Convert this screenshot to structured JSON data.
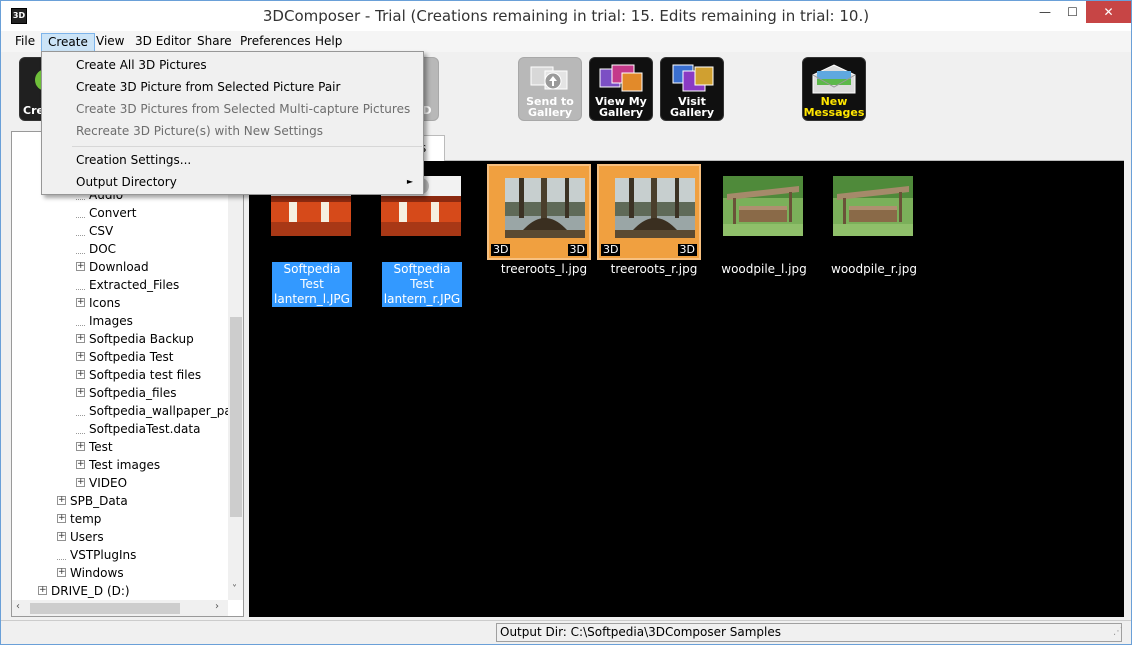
{
  "window": {
    "title": "3DComposer - Trial (Creations remaining in trial: 15. Edits remaining in trial: 10.)",
    "app_icon_text": "3D",
    "controls": {
      "minimize": "—",
      "maximize": "☐",
      "close": "✕"
    }
  },
  "menubar": {
    "items": [
      "File",
      "Create",
      "View",
      "3D Editor",
      "Share",
      "Preferences",
      "Help"
    ],
    "active": "Create"
  },
  "create_menu": {
    "items": [
      {
        "label": "Create All 3D Pictures",
        "enabled": true
      },
      {
        "label": "Create 3D Picture from Selected Picture Pair",
        "enabled": true
      },
      {
        "label": "Create 3D Pictures from Selected Multi-capture Pictures",
        "enabled": false
      },
      {
        "label": "Recreate 3D Picture(s) with New Settings",
        "enabled": false
      },
      {
        "label": "Creation Settings...",
        "enabled": true
      },
      {
        "label": "Output Directory",
        "enabled": true,
        "submenu": true
      }
    ],
    "submenu_arrow": "►"
  },
  "toolbar": {
    "partial_left_label": "Cre",
    "partial_right_label": "D",
    "send_to_gallery": "Send to Gallery",
    "view_my_gallery": "View My Gallery",
    "visit_gallery": "Visit Gallery",
    "new_messages": "New Messages"
  },
  "tree": {
    "items": [
      {
        "label": "Audio",
        "expandable": false,
        "partial": true
      },
      {
        "label": "Convert",
        "expandable": false
      },
      {
        "label": "CSV",
        "expandable": false
      },
      {
        "label": "DOC",
        "expandable": false
      },
      {
        "label": "Download",
        "expandable": true
      },
      {
        "label": "Extracted_Files",
        "expandable": false
      },
      {
        "label": "Icons",
        "expandable": true
      },
      {
        "label": "Images",
        "expandable": false
      },
      {
        "label": "Softpedia Backup",
        "expandable": true
      },
      {
        "label": "Softpedia Test",
        "expandable": true
      },
      {
        "label": "Softpedia test files",
        "expandable": true
      },
      {
        "label": "Softpedia_files",
        "expandable": true
      },
      {
        "label": "Softpedia_wallpaper_pack_",
        "expandable": false
      },
      {
        "label": "SoftpediaTest.data",
        "expandable": false
      },
      {
        "label": "Test",
        "expandable": true
      },
      {
        "label": "Test images",
        "expandable": true
      },
      {
        "label": "VIDEO",
        "expandable": true
      },
      {
        "label": "SPB_Data",
        "expandable": true
      },
      {
        "label": "temp",
        "expandable": true
      },
      {
        "label": "Users",
        "expandable": true
      },
      {
        "label": "VSTPlugIns",
        "expandable": false
      },
      {
        "label": "Windows",
        "expandable": true
      },
      {
        "label": "DRIVE_D (D:)",
        "expandable": true
      }
    ],
    "expander_symbol": "+"
  },
  "tabs": {
    "partial_tab_label": "s"
  },
  "gallery": {
    "items": [
      {
        "caption": "Softpedia Test lantern_l.JPG",
        "selected_caption": true,
        "highlighted": false,
        "theme": "lantern"
      },
      {
        "caption": "Softpedia Test lantern_r.JPG",
        "selected_caption": true,
        "highlighted": false,
        "theme": "lantern"
      },
      {
        "caption": "treeroots_l.jpg",
        "selected_caption": false,
        "highlighted": true,
        "badge": "3D",
        "theme": "roots"
      },
      {
        "caption": "treeroots_r.jpg",
        "selected_caption": false,
        "highlighted": true,
        "badge": "3D",
        "theme": "roots"
      },
      {
        "caption": "woodpile_l.jpg",
        "selected_caption": false,
        "highlighted": false,
        "theme": "woodpile"
      },
      {
        "caption": "woodpile_r.jpg",
        "selected_caption": false,
        "highlighted": false,
        "theme": "woodpile"
      }
    ]
  },
  "statusbar": {
    "output_dir": "Output Dir: C:\\Softpedia\\3DComposer Samples"
  },
  "colors": {
    "selection_blue": "#3399ff",
    "highlight_orange": "#f0a040",
    "close_red": "#c74545",
    "menu_active": "#cce4f7"
  }
}
